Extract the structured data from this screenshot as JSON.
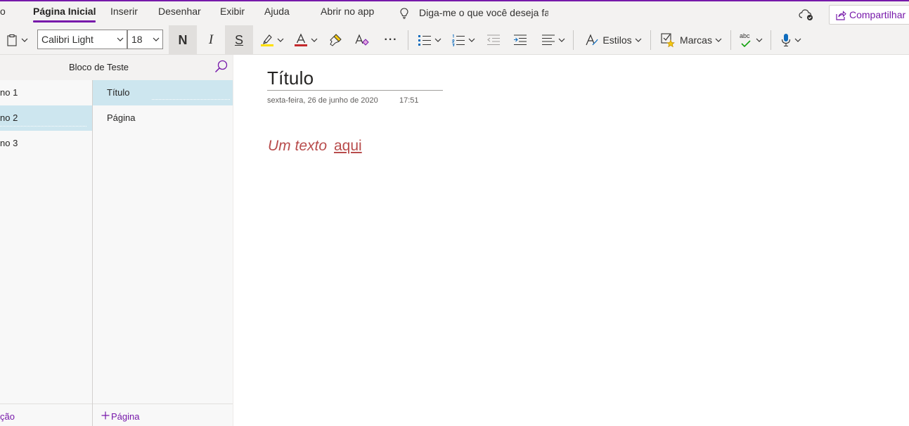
{
  "menu": {
    "tabs": [
      "o",
      "Página Inicial",
      "Inserir",
      "Desenhar",
      "Exibir",
      "Ajuda"
    ],
    "active_tab": "Página Inicial",
    "open_in_app": "Abrir no app",
    "tell_me": "Diga-me o que você deseja fazer",
    "share": "Compartilhar"
  },
  "toolbar": {
    "font_name": "Calibri Light",
    "font_size": "18",
    "bold": "N",
    "italic": "I",
    "strike": "S",
    "more": "···",
    "styles": "Estilos",
    "tags": "Marcas",
    "spell_abc": "abc",
    "highlight_color": "#ffe000",
    "font_color": "#c4292c"
  },
  "notebook": {
    "name": "Bloco de Teste",
    "sections": [
      "no 1",
      "no 2",
      "no 3"
    ],
    "selected_section": "no 2",
    "add_section": "ção"
  },
  "pages": {
    "items": [
      "Título",
      "Página"
    ],
    "selected_page": "Título",
    "add_page": "Página"
  },
  "page": {
    "title": "Título",
    "date": "sexta-feira, 26 de junho de 2020",
    "time": "17:51",
    "text": "Um texto",
    "link": "aqui"
  },
  "colors": {
    "accent": "#7719aa",
    "selection": "#cde6ef",
    "body_text": "#b84c4c"
  }
}
